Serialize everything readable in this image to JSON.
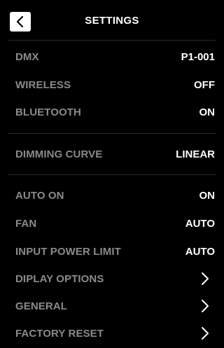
{
  "header": {
    "title": "SETTINGS",
    "back_icon": "chevron-left-icon"
  },
  "groups": [
    {
      "items": [
        {
          "label": "DMX",
          "value": "P1-001"
        },
        {
          "label": "WIRELESS",
          "value": "OFF"
        },
        {
          "label": "BLUETOOTH",
          "value": "ON"
        }
      ]
    },
    {
      "items": [
        {
          "label": "DIMMING CURVE",
          "value": "LINEAR"
        }
      ]
    },
    {
      "items": [
        {
          "label": "AUTO ON",
          "value": "ON"
        },
        {
          "label": "FAN",
          "value": "AUTO"
        },
        {
          "label": "INPUT POWER LIMIT",
          "value": "AUTO"
        },
        {
          "label": "DIPLAY OPTIONS",
          "icon": "chevron-right-icon"
        },
        {
          "label": "GENERAL",
          "icon": "chevron-right-icon"
        },
        {
          "label": "FACTORY RESET",
          "icon": "chevron-right-icon"
        }
      ]
    }
  ],
  "colors": {
    "background": "#000000",
    "label": "#8a8a8a",
    "value": "#ffffff",
    "divider": "#2e2e2e"
  }
}
